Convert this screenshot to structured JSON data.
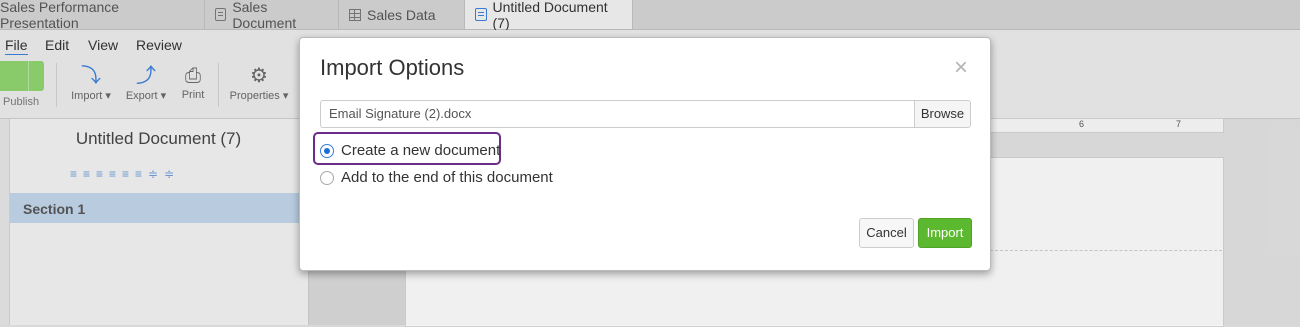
{
  "tabs": [
    {
      "label": "Sales Performance Presentation",
      "active": false
    },
    {
      "label": "Sales Document",
      "active": false
    },
    {
      "label": "Sales Data",
      "active": false
    },
    {
      "label": "Untitled Document (7)",
      "active": true
    }
  ],
  "menu": {
    "file": "File",
    "edit": "Edit",
    "view": "View",
    "review": "Review"
  },
  "toolbar": {
    "publish": "Publish",
    "import": "Import",
    "export": "Export",
    "print": "Print",
    "properties": "Properties"
  },
  "sidebar": {
    "document_title": "Untitled Document (7)",
    "section": "Section 1"
  },
  "ruler": {
    "mark6": "6",
    "mark7": "7"
  },
  "dialog": {
    "title": "Import Options",
    "file_value": "Email Signature (2).docx",
    "browse": "Browse",
    "option_new": "Create a new document",
    "option_append": "Add to the end of this document",
    "selected_option": "option_new",
    "cancel": "Cancel",
    "import": "Import"
  },
  "colors": {
    "accent": "#3b7dd8",
    "import_button": "#5cb82f",
    "highlight": "#6b2d8a"
  }
}
